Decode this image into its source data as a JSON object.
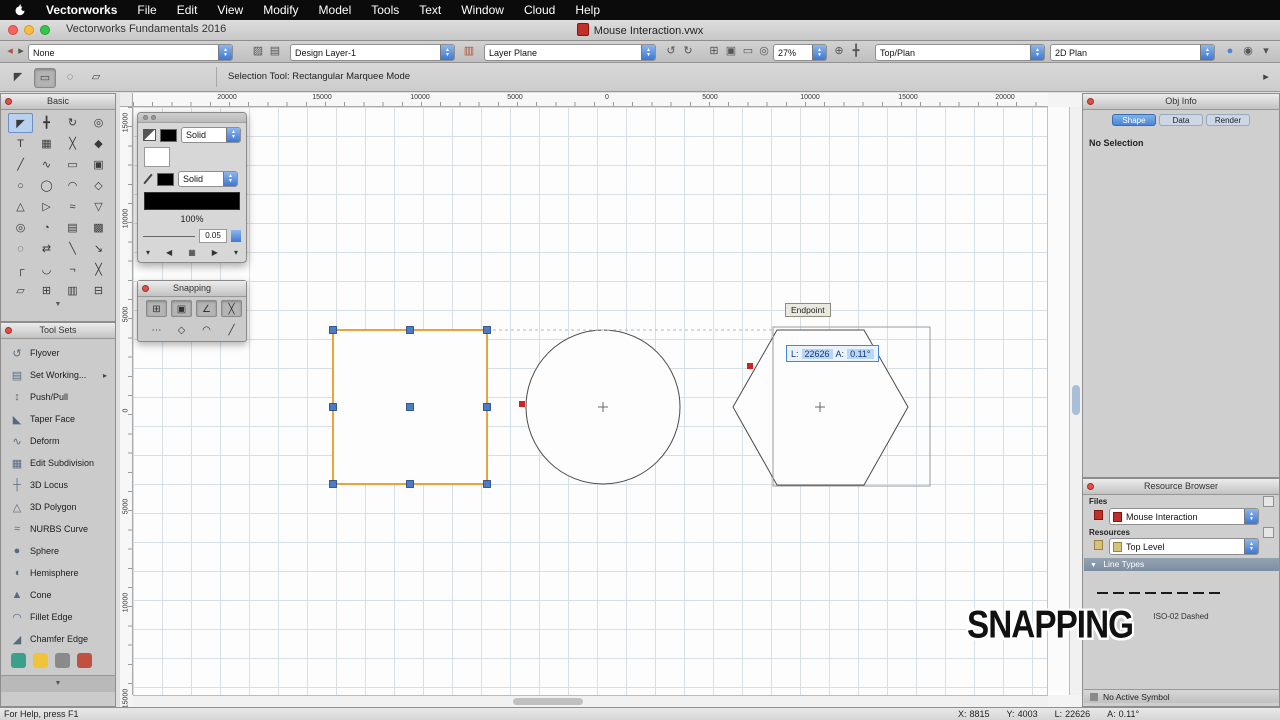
{
  "colors": {
    "selection": "#e8a33b",
    "handle": "#4a7cc8",
    "snap": "#cc2222",
    "accent": "#4a86d8",
    "caption": "#111111"
  },
  "menu_bar": {
    "items": [
      "Vectorworks",
      "File",
      "Edit",
      "View",
      "Modify",
      "Model",
      "Tools",
      "Text",
      "Window",
      "Cloud",
      "Help"
    ]
  },
  "title_bar": {
    "app_title": "Vectorworks Fundamentals 2016",
    "doc_title": "Mouse Interaction.vwx"
  },
  "toolbar": {
    "class_value": "None",
    "layer_value": "Design Layer-1",
    "plane_value": "Layer Plane",
    "zoom_value": "27%",
    "view_value": "Top/Plan",
    "render_value": "2D Plan",
    "icons": [
      "◂",
      "▸",
      "▨",
      "▤",
      "▥",
      "↺",
      "↻",
      "⊞",
      "▣",
      "▭",
      "◎",
      "⊕",
      "╋",
      "●",
      "◉",
      "▾"
    ]
  },
  "mode_bar": {
    "status": "Selection Tool: Rectangular Marquee Mode",
    "icons": [
      "◤",
      "▭",
      "◌",
      "▱",
      "▸"
    ]
  },
  "basic_palette": {
    "title": "Basic",
    "tools": [
      "◤",
      "╋",
      "↻",
      "◎",
      "T",
      "▦",
      "╳",
      "◆",
      "╱",
      "∿",
      "▭",
      "▣",
      "○",
      "◯",
      "◠",
      "◇",
      "△",
      "▷",
      "≈",
      "▽",
      "◎",
      "◔",
      "▤",
      "▩",
      "◌",
      "⇄",
      "╲",
      "↘",
      "┌",
      "◡",
      "¬",
      "╳",
      "▱",
      "⊞",
      "▥",
      "⊟"
    ]
  },
  "attributes_palette": {
    "fill_style": "Solid",
    "pen_style": "Solid",
    "opacity": "100%",
    "line_weight": "0.05",
    "nav": [
      "▾",
      "◀",
      "▦",
      "▶",
      "▾"
    ]
  },
  "snapping_palette": {
    "title": "Snapping",
    "row1": [
      "⊞",
      "▣",
      "∠",
      "╳"
    ],
    "row2": [
      "⋯",
      "◇",
      "◠",
      "╱"
    ]
  },
  "tool_sets": {
    "title": "Tool Sets",
    "items": [
      {
        "glyph": "↺",
        "label": "Flyover"
      },
      {
        "glyph": "▤",
        "label": "Set Working..."
      },
      {
        "glyph": "↕",
        "label": "Push/Pull"
      },
      {
        "glyph": "◣",
        "label": "Taper Face"
      },
      {
        "glyph": "∿",
        "label": "Deform"
      },
      {
        "glyph": "▦",
        "label": "Edit Subdivision"
      },
      {
        "glyph": "┼",
        "label": "3D Locus"
      },
      {
        "glyph": "△",
        "label": "3D Polygon"
      },
      {
        "glyph": "≈",
        "label": "NURBS Curve"
      },
      {
        "glyph": "●",
        "label": "Sphere"
      },
      {
        "glyph": "◖",
        "label": "Hemisphere"
      },
      {
        "glyph": "▲",
        "label": "Cone"
      },
      {
        "glyph": "◠",
        "label": "Fillet Edge"
      },
      {
        "glyph": "◢",
        "label": "Chamfer Edge"
      }
    ]
  },
  "canvas": {
    "ruler_top": [
      "20000",
      "15000",
      "10000",
      "5000",
      "0",
      "5000",
      "10000",
      "15000",
      "20000"
    ],
    "ruler_left": [
      "15000",
      "10000",
      "5000",
      "0",
      "5000",
      "10000",
      "15000"
    ],
    "tooltip": "Endpoint",
    "databar": {
      "l_label": "L:",
      "l_value": "22626",
      "a_label": "A:",
      "a_value": "0.11°"
    },
    "caption": "SNAPPING"
  },
  "obj_info": {
    "title": "Obj Info",
    "tabs": [
      "Shape",
      "Data",
      "Render"
    ],
    "status": "No Selection"
  },
  "resource_browser": {
    "title": "Resource Browser",
    "files_label": "Files",
    "file_value": "Mouse Interaction",
    "resources_label": "Resources",
    "resource_value": "Top Level",
    "section_label": "Line Types",
    "line_type_label": "ISO-02 Dashed",
    "footer": "No Active Symbol"
  },
  "status_bar": {
    "help": "For Help, press F1",
    "items": [
      {
        "label": "X:",
        "value": "8815"
      },
      {
        "label": "Y:",
        "value": "4003"
      },
      {
        "label": "L:",
        "value": "22626"
      },
      {
        "label": "A:",
        "value": "0.11°"
      }
    ]
  }
}
